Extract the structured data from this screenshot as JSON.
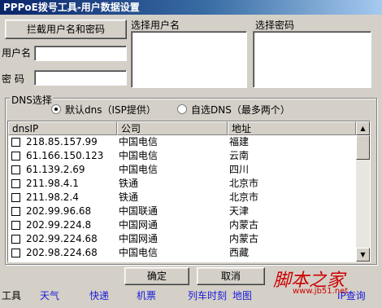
{
  "window": {
    "title": "PPPoE拨号工具-用户数据设置"
  },
  "intercept_button": "拦截用户名和密码",
  "labels": {
    "username": "用户名",
    "password": "密 码",
    "select_username": "选择用户名",
    "select_password": "选择密码"
  },
  "inputs": {
    "username_value": "",
    "password_value": ""
  },
  "dns_group": {
    "title": "DNS选择",
    "radio_default": "默认dns（ISP提供）",
    "radio_custom": "自选DNS（最多两个）",
    "selected": "默认dns（ISP提供）"
  },
  "table": {
    "columns": [
      "dnsIP",
      "公司",
      "地址"
    ],
    "rows": [
      {
        "ip": "218.85.157.99",
        "company": "中国电信",
        "location": "福建",
        "checked": false
      },
      {
        "ip": "61.166.150.123",
        "company": "中国电信",
        "location": "云南",
        "checked": false
      },
      {
        "ip": "61.139.2.69",
        "company": "中国电信",
        "location": "四川",
        "checked": false
      },
      {
        "ip": "211.98.4.1",
        "company": "铁通",
        "location": "北京市",
        "checked": false
      },
      {
        "ip": "211.98.2.4",
        "company": "铁通",
        "location": "北京市",
        "checked": false
      },
      {
        "ip": "202.99.96.68",
        "company": "中国联通",
        "location": "天津",
        "checked": false
      },
      {
        "ip": "202.99.224.8",
        "company": "中国网通",
        "location": "内蒙古",
        "checked": false
      },
      {
        "ip": "202.99.224.68",
        "company": "中国网通",
        "location": "内蒙古",
        "checked": false
      },
      {
        "ip": "202.98.224.68",
        "company": "中国电信",
        "location": "西藏",
        "checked": false
      }
    ]
  },
  "buttons": {
    "ok": "确定",
    "cancel": "取消"
  },
  "toolbar": {
    "label": "工具",
    "links": [
      "天气",
      "快递",
      "机票",
      "列车时刻",
      "地图",
      "IP查询"
    ]
  },
  "watermark": {
    "logo": "脚本之家",
    "url": "www.jb51.net"
  },
  "colors": {
    "title_bar": "#0a246a",
    "link": "#1a1adc",
    "window_bg": "#d4d0c8",
    "watermark": "#cc0000"
  }
}
